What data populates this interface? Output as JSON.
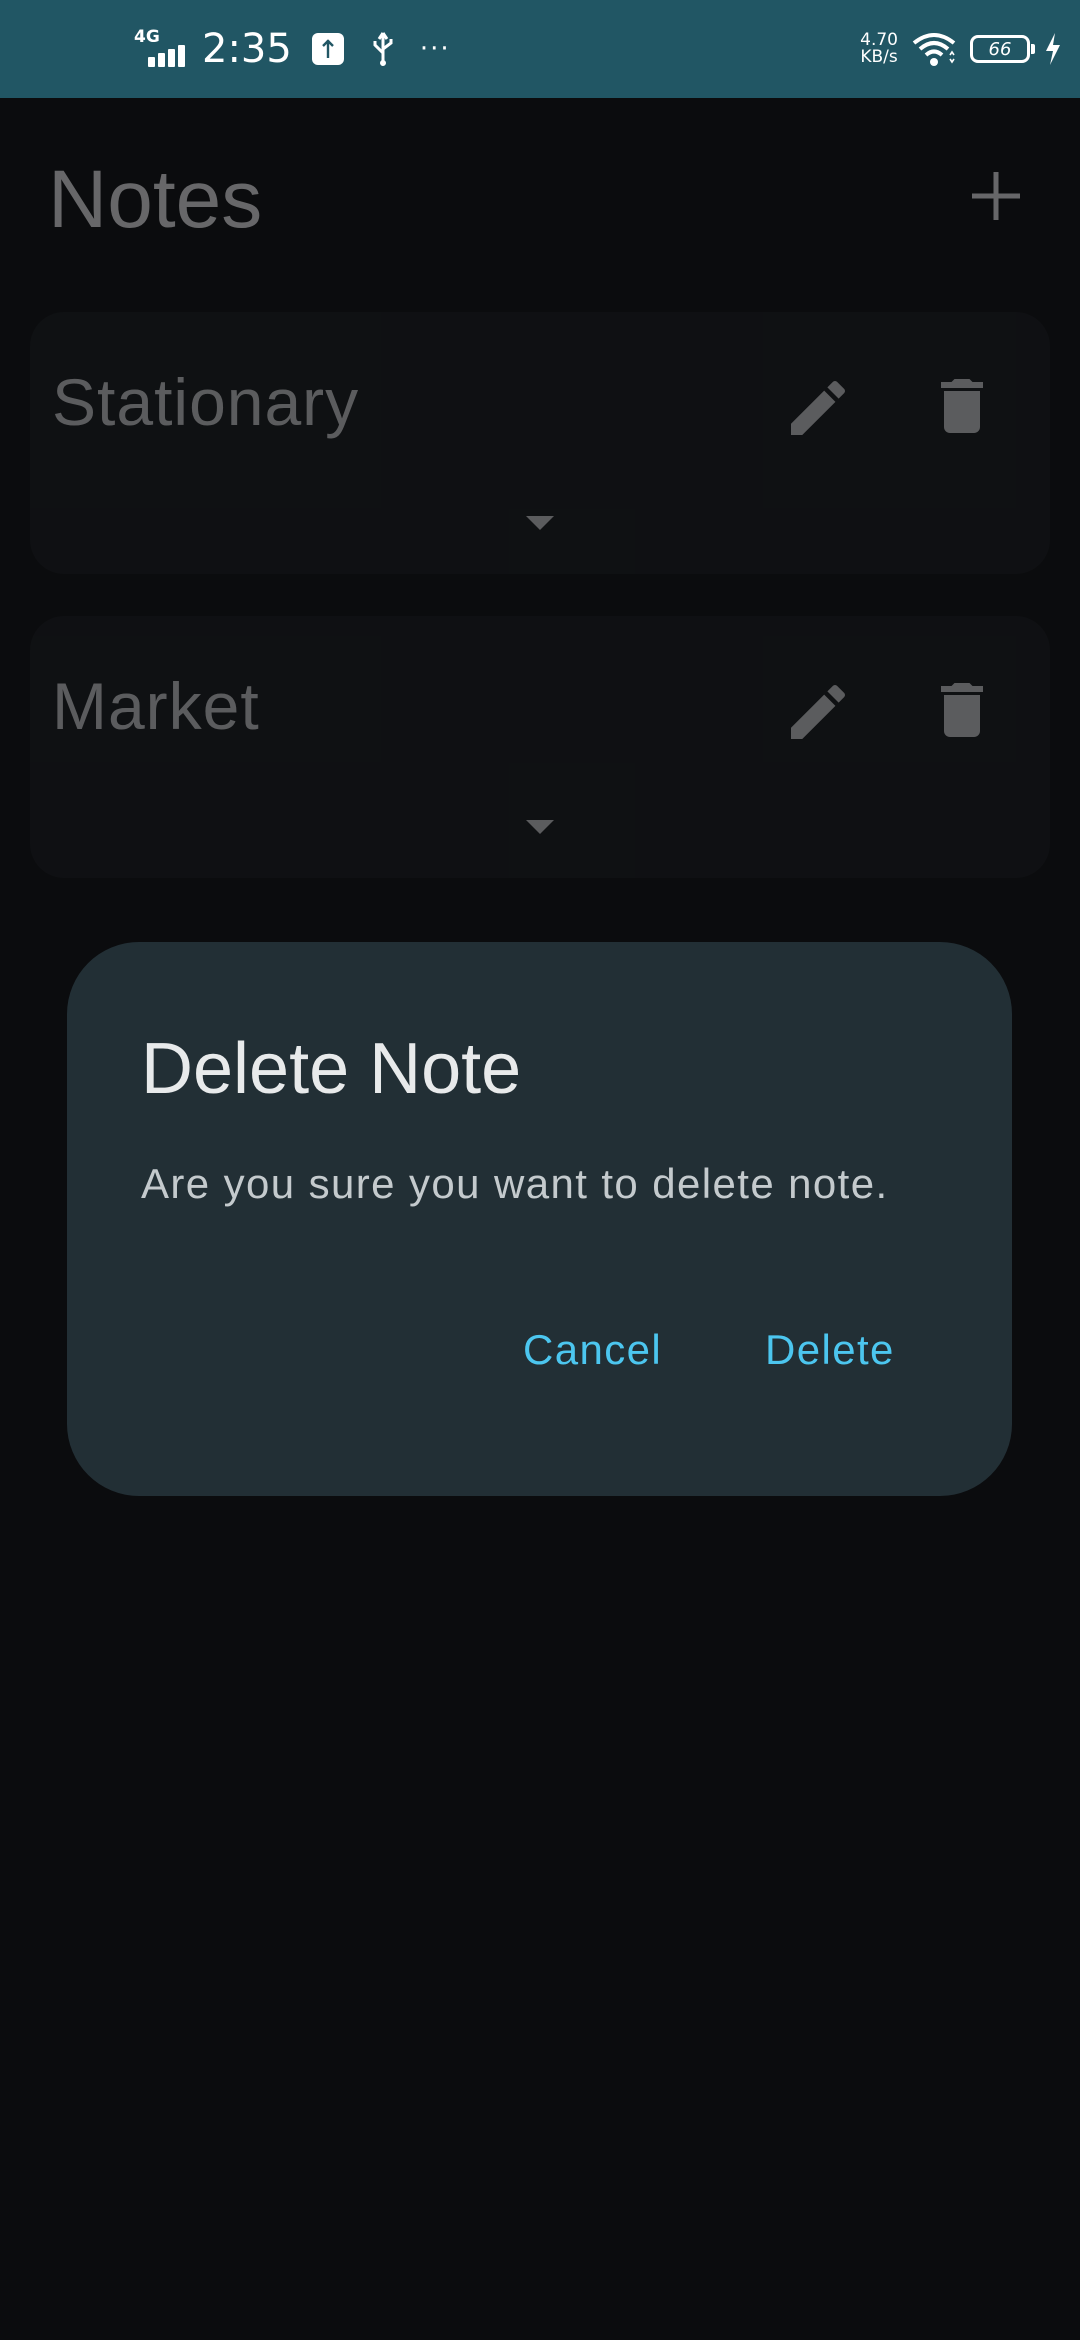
{
  "status_bar": {
    "network": "4G",
    "time": "2:35",
    "more": "···",
    "speed_value": "4.70",
    "speed_unit": "KB/s",
    "battery": "66"
  },
  "page": {
    "title": "Notes",
    "add_icon": "plus-icon"
  },
  "notes": [
    {
      "title": "Stationary",
      "edit_icon": "pencil-icon",
      "delete_icon": "trash-icon",
      "expand_icon": "caret-down-icon"
    },
    {
      "title": "Market",
      "edit_icon": "pencil-icon",
      "delete_icon": "trash-icon",
      "expand_icon": "caret-down-icon"
    }
  ],
  "dialog": {
    "title": "Delete Note",
    "message": "Are you sure you want to delete note.",
    "cancel_label": "Cancel",
    "delete_label": "Delete"
  },
  "colors": {
    "status_bar_bg": "#215664",
    "background": "#0b0c0e",
    "card_bg": "#101214",
    "dialog_bg": "#222f35",
    "accent": "#4cc6ef"
  }
}
